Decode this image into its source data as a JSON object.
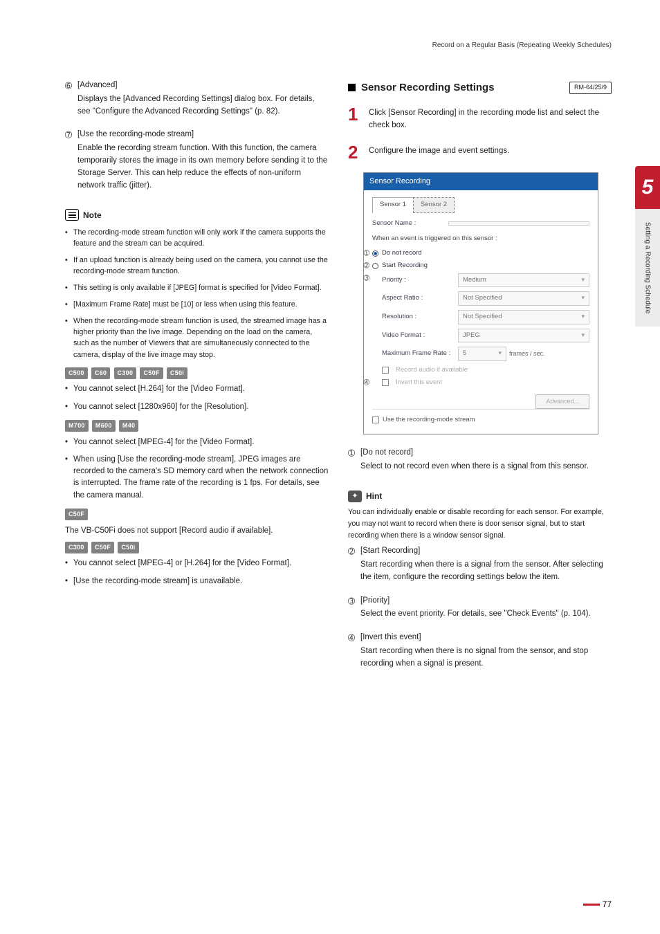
{
  "header": "Record on a Regular Basis (Repeating Weekly Schedules)",
  "chapter": {
    "num": "5",
    "label": "Setting a Recording Schedule"
  },
  "left": {
    "item6": {
      "num": "➅",
      "title": "[Advanced]",
      "desc": "Displays the [Advanced Recording Settings] dialog box. For details, see \"Configure the Advanced Recording Settings\" (p. 82)."
    },
    "item7": {
      "num": "➆",
      "title": "[Use the recording-mode stream]",
      "desc": "Enable the recording stream function. With this function, the camera temporarily stores the image in its own memory before sending it to the Storage Server. This can help reduce the effects of non-uniform network traffic (jitter)."
    },
    "note_label": "Note",
    "note": {
      "b1": "The recording-mode stream function will only work if the camera supports the feature and the stream can be acquired.",
      "b2": "If an upload function is already being used on the camera, you cannot use the recording-mode stream function.",
      "b3": "This setting is only available if [JPEG] format is specified for [Video Format].",
      "b4": "[Maximum Frame Rate] must be [10] or less when using this feature.",
      "b5": "When the recording-mode stream function is used, the streamed image has a higher priority than the live image. Depending on the load on the camera, such as the number of Viewers that are simultaneously connected to the camera, display of the live image may stop."
    },
    "tagsA": [
      "C500",
      "C60",
      "C300",
      "C50F",
      "C50i"
    ],
    "a1": "You cannot select [H.264] for the [Video Format].",
    "a2": "You cannot select [1280x960] for the [Resolution].",
    "tagsB": [
      "M700",
      "M600",
      "M40"
    ],
    "bL1": "You cannot select [MPEG-4] for the [Video Format].",
    "bL2": "When using [Use the recording-mode stream], JPEG images are recorded to the camera's SD memory card when the network connection is interrupted. The frame rate of the recording is 1 fps. For details, see the camera manual.",
    "tagsC": [
      "C50F"
    ],
    "cText": "The VB-C50Fi does not support [Record audio if available].",
    "tagsD": [
      "C300",
      "C50F",
      "C50i"
    ],
    "d1": "You cannot select [MPEG-4] or [H.264] for the [Video Format].",
    "d2": "[Use the recording-mode stream] is unavailable."
  },
  "right": {
    "title": "Sensor Recording Settings",
    "rm": "RM-64/25/9",
    "step1": "Click [Sensor Recording] in the recording mode list and select the check box.",
    "step2": "Configure the image and event settings.",
    "shot": {
      "title": "Sensor Recording",
      "tab1": "Sensor 1",
      "tab2": "Sensor 2",
      "sensorNameLabel": "Sensor Name :",
      "triggerLabel": "When an event is triggered on this sensor :",
      "r1": "Do not record",
      "r2": "Start Recording",
      "priorityLabel": "Priority :",
      "priorityVal": "Medium",
      "aspectLabel": "Aspect Ratio :",
      "aspectVal": "Not Specified",
      "resLabel": "Resolution :",
      "resVal": "Not Specified",
      "vfLabel": "Video Format :",
      "vfVal": "JPEG",
      "mfrLabel": "Maximum Frame Rate :",
      "mfrVal": "5",
      "mfrUnit": "frames / sec.",
      "recAudio": "Record audio if available",
      "invert": "Invert this event",
      "adv": "Advanced...",
      "footer": "Use the recording-mode stream"
    },
    "d1": {
      "num": "➀",
      "title": "[Do not record]",
      "desc": "Select to not record even when there is a signal from this sensor."
    },
    "hint_label": "Hint",
    "hint": "You can individually enable or disable recording for each sensor. For example, you may not want to record when there is door sensor signal, but to start recording when there is a window sensor signal.",
    "d2": {
      "num": "➁",
      "title": "[Start Recording]",
      "desc": "Start recording when there is a signal from the sensor. After selecting the item, configure the recording settings below the item."
    },
    "d3": {
      "num": "➂",
      "title": "[Priority]",
      "desc": "Select the event priority. For details, see \"Check Events\" (p. 104)."
    },
    "d4": {
      "num": "➃",
      "title": "[Invert this event]",
      "desc": "Start recording when there is no signal from the sensor, and stop recording when a signal is present."
    }
  },
  "callouts": {
    "c1": "➀",
    "c2": "➁",
    "c3": "➂",
    "c4": "➃"
  },
  "page_number": "77"
}
